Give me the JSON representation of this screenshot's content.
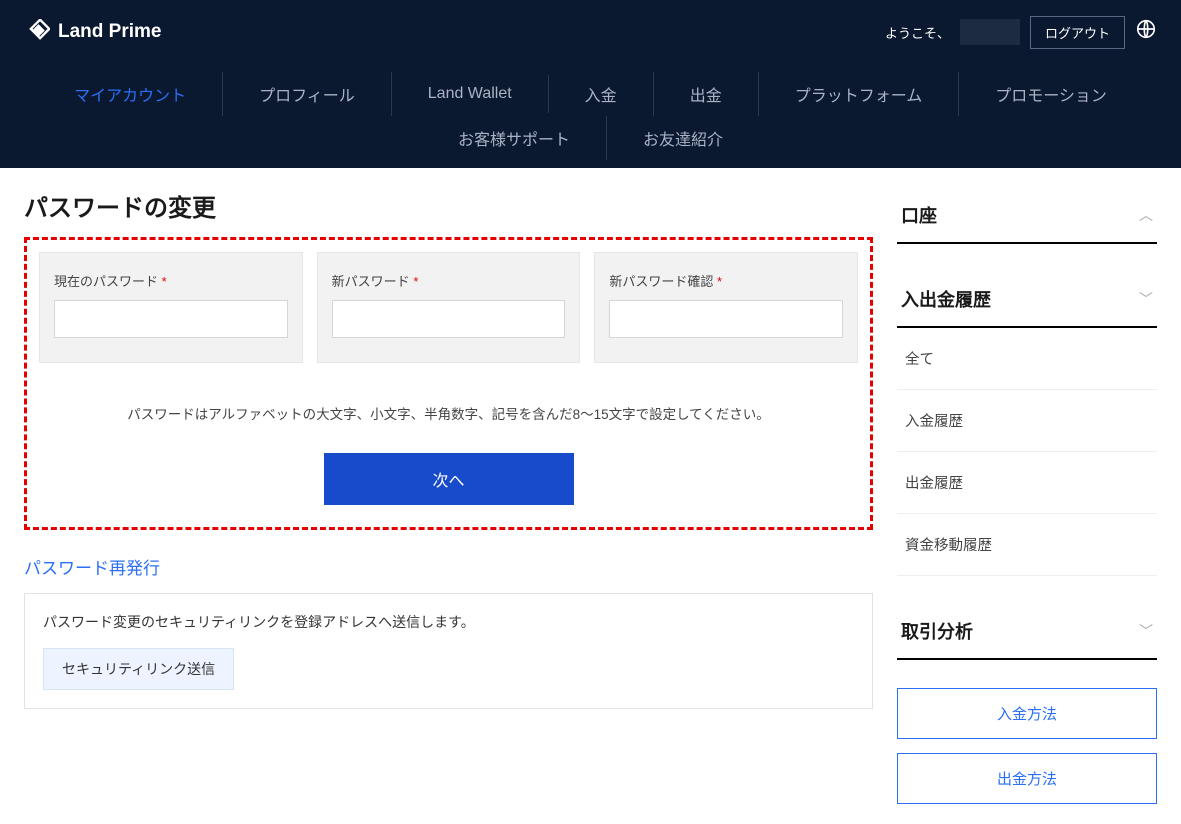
{
  "header": {
    "brand": "Land Prime",
    "welcome": "ようこそ、",
    "logout": "ログアウト"
  },
  "nav": {
    "items": [
      "マイアカウント",
      "プロフィール",
      "Land Wallet",
      "入金",
      "出金",
      "プラットフォーム",
      "プロモーション",
      "お客様サポート",
      "お友達紹介"
    ]
  },
  "main": {
    "title": "パスワードの変更",
    "fields": {
      "current": "現在のパスワード",
      "new": "新パスワード",
      "confirm": "新パスワード確認"
    },
    "hint": "パスワードはアルファベットの大文字、小文字、半角数字、記号を含んだ8～15文字で設定してください。",
    "next": "次へ",
    "reissue_title": "パスワード再発行",
    "reissue_text": "パスワード変更のセキュリティリンクを登録アドレスへ送信します。",
    "reissue_btn": "セキュリティリンク送信"
  },
  "sidebar": {
    "sections": {
      "account": "口座",
      "history": "入出金履歴",
      "analysis": "取引分析"
    },
    "history_items": [
      "全て",
      "入金履歴",
      "出金履歴",
      "資金移動履歴"
    ],
    "actions": [
      "入金方法",
      "出金方法"
    ]
  }
}
